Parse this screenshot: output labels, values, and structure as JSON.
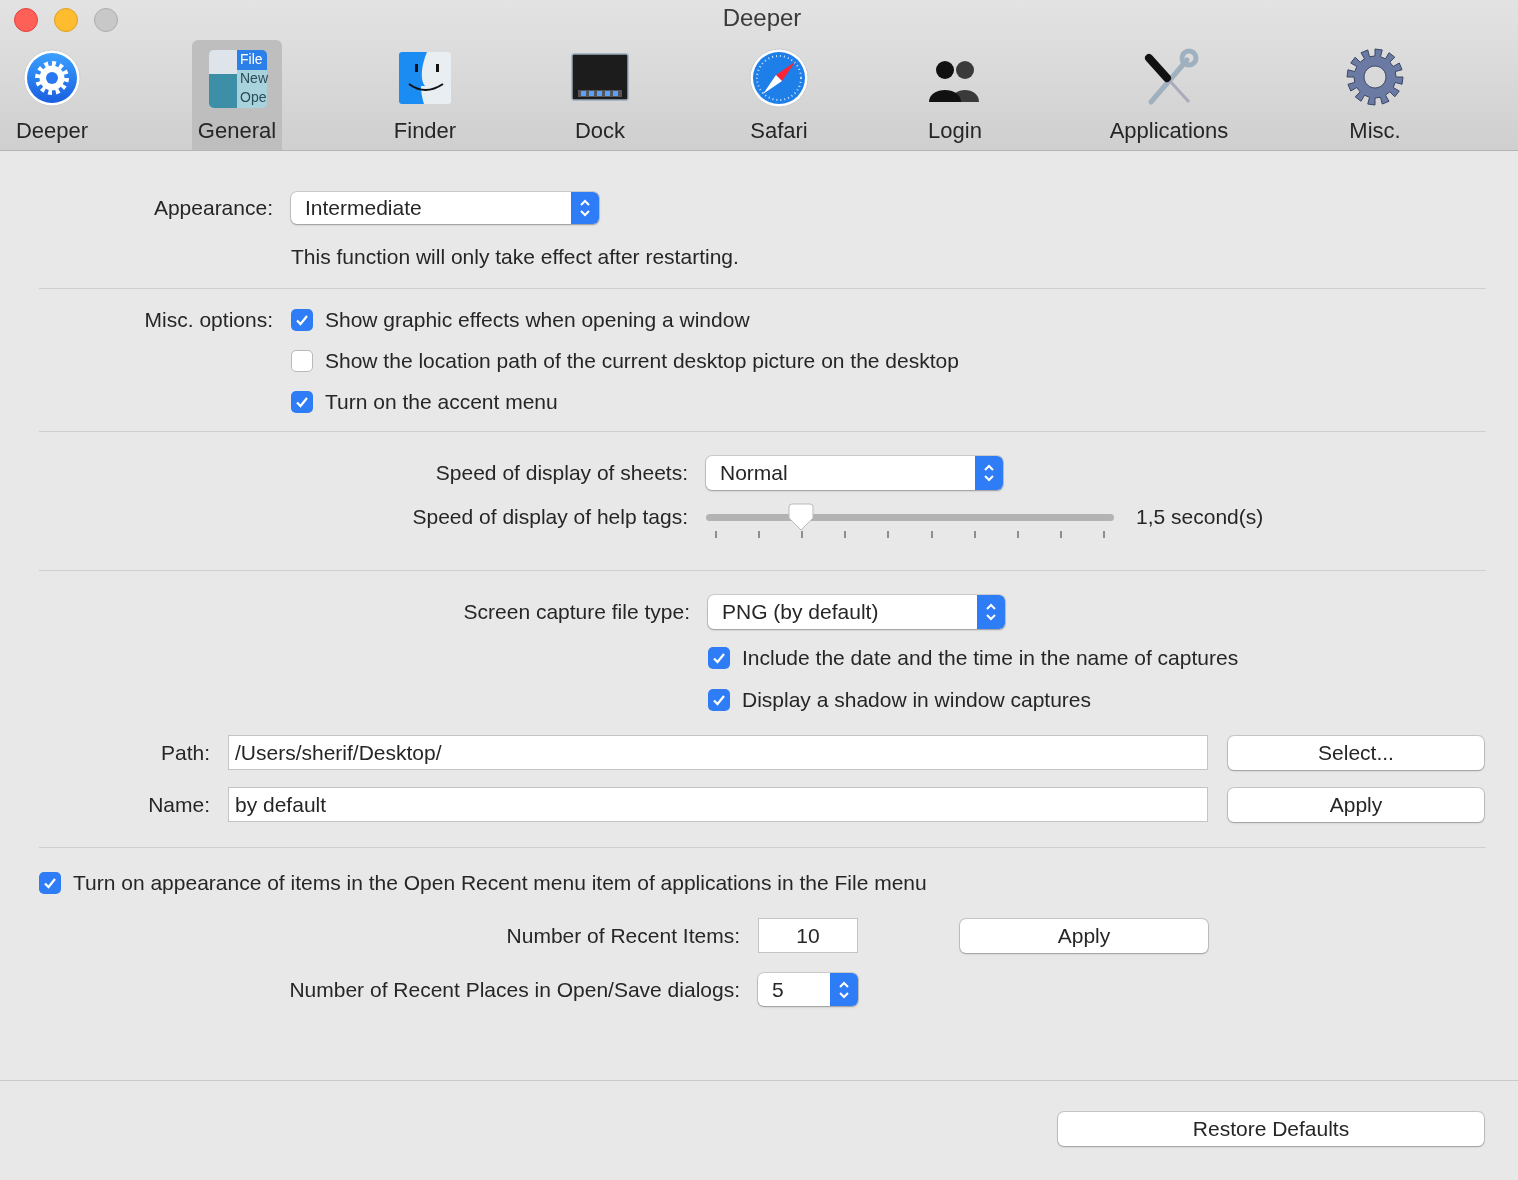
{
  "window": {
    "title": "Deeper"
  },
  "toolbar": [
    {
      "label": "Deeper",
      "kind": "deeper",
      "selected": false
    },
    {
      "label": "General",
      "kind": "general",
      "selected": true,
      "icon_lines": [
        "File",
        "New",
        "Ope"
      ]
    },
    {
      "label": "Finder",
      "kind": "finder",
      "selected": false
    },
    {
      "label": "Dock",
      "kind": "dock",
      "selected": false
    },
    {
      "label": "Safari",
      "kind": "safari",
      "selected": false
    },
    {
      "label": "Login",
      "kind": "login",
      "selected": false
    },
    {
      "label": "Applications",
      "kind": "applications",
      "selected": false
    },
    {
      "label": "Misc.",
      "kind": "misc",
      "selected": false
    }
  ],
  "appearance": {
    "label": "Appearance:",
    "value": "Intermediate",
    "note": "This function will only take effect after restarting."
  },
  "misc_options": {
    "label": "Misc. options:",
    "options": [
      {
        "label": "Show graphic effects when opening a window",
        "checked": true
      },
      {
        "label": "Show the location path of the current desktop picture on the desktop",
        "checked": false
      },
      {
        "label": "Turn on the accent menu",
        "checked": true
      }
    ]
  },
  "sheets_speed": {
    "label": "Speed of display of sheets:",
    "value": "Normal"
  },
  "help_tags_speed": {
    "label": "Speed of display of help tags:",
    "level": 0.22,
    "reading": "1,5 second(s)"
  },
  "screen_capture": {
    "label": "Screen capture file type:",
    "value": "PNG (by default)",
    "options": [
      {
        "label": "Include the date and the time in the name of captures",
        "checked": true
      },
      {
        "label": "Display a shadow in window captures",
        "checked": true
      }
    ],
    "path": {
      "label": "Path:",
      "value": "/Users/sherif/Desktop/",
      "button": "Select..."
    },
    "name": {
      "label": "Name:",
      "value": "by default",
      "button": "Apply"
    }
  },
  "open_recent": {
    "label": "Turn on appearance of items in the Open Recent menu item of applications in the File menu",
    "checked": true,
    "recent_items": {
      "label": "Number of Recent Items:",
      "value": "10",
      "button": "Apply"
    },
    "recent_places": {
      "label": "Number of Recent Places in Open/Save dialogs:",
      "value": "5"
    }
  },
  "restore_button": "Restore Defaults"
}
